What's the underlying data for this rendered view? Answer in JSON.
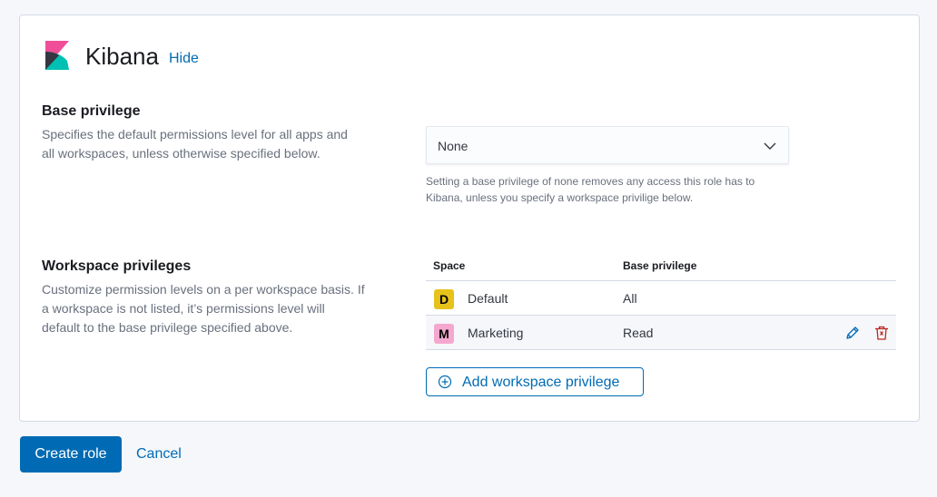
{
  "app": {
    "title": "Kibana",
    "hide_label": "Hide"
  },
  "base_privilege": {
    "title": "Base privilege",
    "description_line1": "Specifies the default permissions level for all apps and",
    "description_line2": "all workspaces, unless otherwise specified below.",
    "selected_value": "None",
    "help_line1": "Setting a base privilege of none removes any access this role has to",
    "help_line2": "Kibana, unless you specify a workspace privilige below."
  },
  "workspace_privileges": {
    "title": "Workspace privileges",
    "description_line1": "Customize permission levels on a per workspace basis. If",
    "description_line2": "a workspace is not listed, it’s permissions level will",
    "description_line3": "default to the base privilege specified above.",
    "columns": [
      "Space",
      "Base privilege"
    ],
    "rows": [
      {
        "initial": "D",
        "name": "Default",
        "privilege": "All",
        "avatar_color": "#e7c21b"
      },
      {
        "initial": "M",
        "name": "Marketing",
        "privilege": "Read",
        "avatar_color": "#f5a8cf"
      }
    ],
    "add_label": "Add workspace privilege"
  },
  "actions": {
    "create_label": "Create role",
    "cancel_label": "Cancel"
  },
  "icons": {
    "edit": "pencil-icon",
    "delete": "trash-icon",
    "add": "plus-circle-icon",
    "select": "chevron-down-icon"
  },
  "colors": {
    "primary": "#006bb4",
    "danger": "#bd271e"
  }
}
